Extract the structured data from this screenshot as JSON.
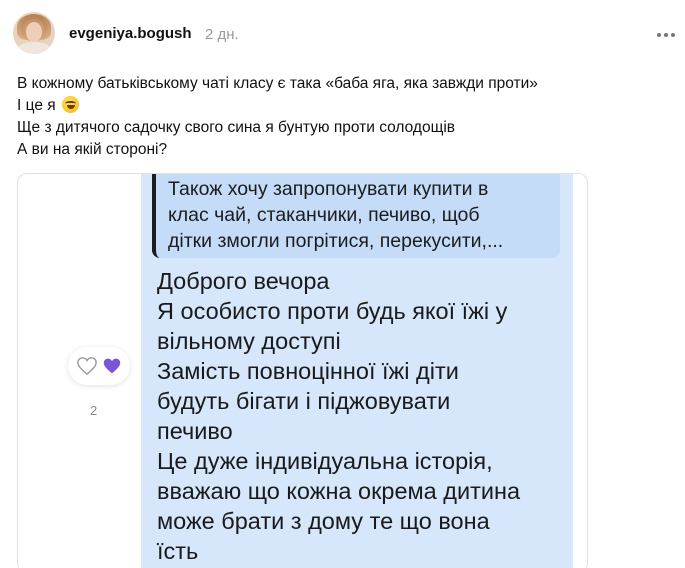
{
  "post": {
    "username": "evgeniya.bogush",
    "timestamp": "2 дн.",
    "caption_lines": [
      "В кожному батьківському чаті класу є така «баба яга, яка завжди проти»",
      "І це я",
      "Ще з дитячого садочку свого сина я бунтую проти солодощів",
      "А ви на якій стороні?"
    ],
    "caption_emoji": "rolling-on-floor-laughing-emoji"
  },
  "media": {
    "quote_lines": [
      "Також хочу запропонувати купити в",
      "клас чай, стаканчики, печиво, щоб",
      "дітки змогли погрітися, перекусити,..."
    ],
    "message_lines": [
      "Доброго вечора",
      "Я особисто проти будь якої їжі у",
      "вільному доступі",
      "Замість повноцінної їжі діти",
      "будуть бігати і піджовувати",
      "печиво",
      "Це дуже індивідуальна історія,",
      "вважаю що кожна окрема дитина",
      "може брати з дому те що вона",
      "їсть"
    ],
    "reactions": {
      "count": "2",
      "icons": [
        "white-heart-icon",
        "purple-heart-icon"
      ],
      "colors": {
        "purple": "#7b55d6",
        "outline": "#9a9a9a"
      }
    },
    "colors": {
      "bubble": "#d6e7fb",
      "quote": "#c4dcf7"
    }
  }
}
